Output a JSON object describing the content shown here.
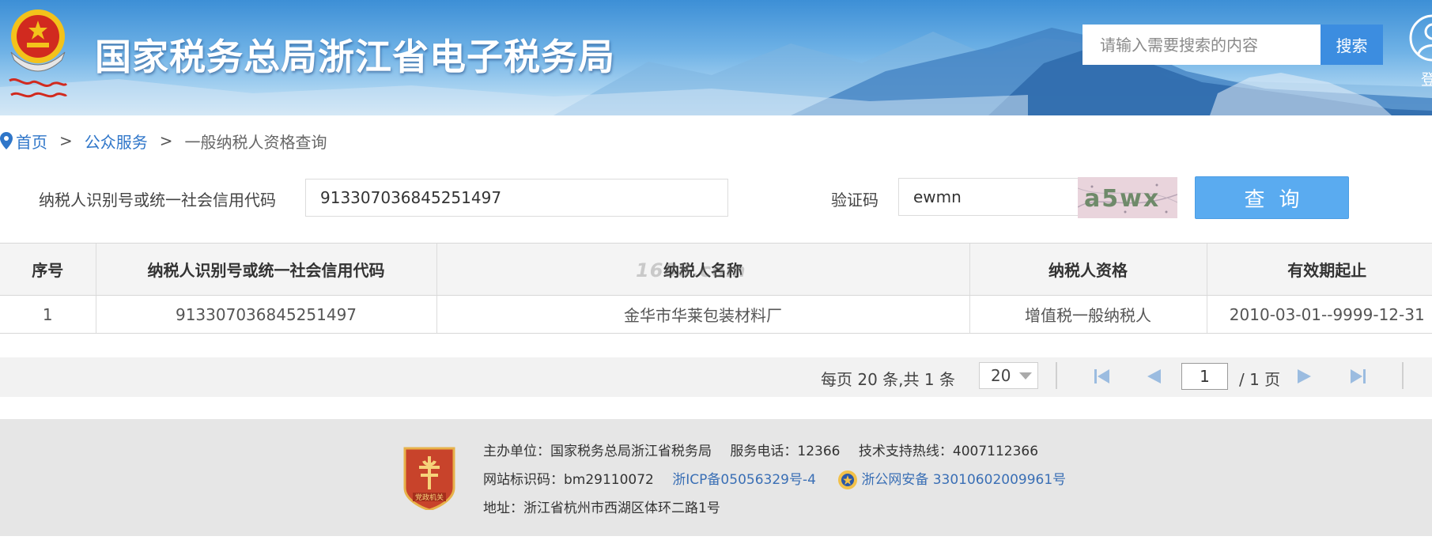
{
  "header": {
    "site_title": "国家税务总局浙江省电子税务局",
    "logo_text": "中国税务",
    "search_placeholder": "请输入需要搜索的内容",
    "search_button": "搜索",
    "login_label": "登"
  },
  "breadcrumb": {
    "home": "首页",
    "separator": ">",
    "section": "公众服务",
    "current": "一般纳税人资格查询"
  },
  "form": {
    "taxpayer_id_label": "纳税人识别号或统一社会信用代码",
    "taxpayer_id_value": "913307036845251497",
    "captcha_label": "验证码",
    "captcha_input_value": "ewmn",
    "captcha_image_text": "a5wx",
    "query_button": "查询"
  },
  "table": {
    "columns": [
      "序号",
      "纳税人识别号或统一社会信用代码",
      "纳税人名称",
      "纳税人资格",
      "有效期起止"
    ],
    "rows": [
      [
        "1",
        "913307036845251497",
        "金华市华莱包装材料厂",
        "增值税一般纳税人",
        "2010-03-01--9999-12-31"
      ]
    ],
    "watermark": "1688.com"
  },
  "pagination": {
    "summary": "每页 20 条,共 1 条",
    "page_size": "20",
    "current_page": "1",
    "total_pages": "/ 1 页"
  },
  "footer": {
    "organizer": "主办单位：国家税务总局浙江省税务局",
    "service_phone": "服务电话：12366",
    "support_hotline": "技术支持热线：4007112366",
    "site_id": "网站标识码：bm29110072",
    "icp": "浙ICP备05056329号-4",
    "police_record": "浙公网安备 33010602009961号",
    "address": "地址：浙江省杭州市西湖区体环二路1号",
    "badge_text": "党政机关"
  },
  "colors": {
    "link": "#2f76c9",
    "primary_button": "#5aabf0",
    "search_button": "#3c8de0",
    "emblem_red": "#d12a1f",
    "emblem_gold": "#f3c21b"
  }
}
